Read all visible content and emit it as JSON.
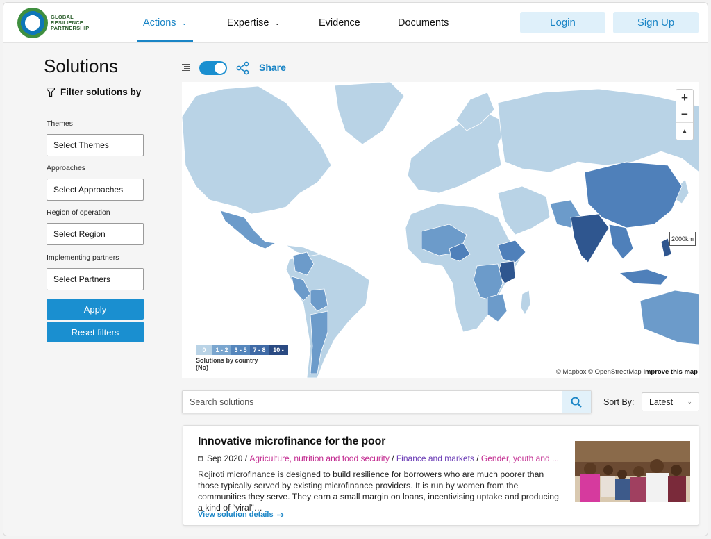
{
  "header": {
    "logo_lines": [
      "GLOBAL",
      "RESILIENCE",
      "PARTNERSHIP"
    ],
    "nav": [
      {
        "label": "Actions",
        "active": true,
        "has_dropdown": true
      },
      {
        "label": "Expertise",
        "active": false,
        "has_dropdown": true
      },
      {
        "label": "Evidence",
        "active": false,
        "has_dropdown": false
      },
      {
        "label": "Documents",
        "active": false,
        "has_dropdown": false
      }
    ],
    "login_label": "Login",
    "signup_label": "Sign Up"
  },
  "sidebar": {
    "title": "Solutions",
    "filter_heading": "Filter solutions by",
    "filters": [
      {
        "label": "Themes",
        "placeholder": "Select Themes"
      },
      {
        "label": "Approaches",
        "placeholder": "Select Approaches"
      },
      {
        "label": "Region of operation",
        "placeholder": "Select Region"
      },
      {
        "label": "Implementing partners",
        "placeholder": "Select Partners"
      }
    ],
    "apply_label": "Apply",
    "reset_label": "Reset filters"
  },
  "toolbar": {
    "map_toggle_on": true,
    "share_label": "Share"
  },
  "map": {
    "zoom_in": "+",
    "zoom_out": "−",
    "compass": "▲",
    "scale_label": "2000km",
    "legend": {
      "bins": [
        {
          "label": "0",
          "color": "#b9d3e6"
        },
        {
          "label": "1 - 2",
          "color": "#7aa6cf"
        },
        {
          "label": "3 - 5",
          "color": "#5586bc"
        },
        {
          "label": "7 - 8",
          "color": "#3f6aa6"
        },
        {
          "label": "10 -",
          "color": "#2a4a82"
        }
      ],
      "title_line1": "Solutions by country",
      "title_line2": "(No)"
    },
    "attribution": "© Mapbox © OpenStreetMap",
    "attribution_link": "Improve this map",
    "colors": {
      "ocean": "#ffffff",
      "land_zero": "#b9d3e6",
      "low": "#6c9bca",
      "mid": "#4f80ba",
      "high": "#2f568f"
    }
  },
  "search": {
    "placeholder": "Search solutions",
    "sort_label": "Sort By:",
    "sort_value": "Latest"
  },
  "results": [
    {
      "title": "Innovative microfinance for the poor",
      "date": "Sep 2020",
      "tags": [
        {
          "text": "Agriculture, nutrition and food security",
          "color": "#c2298f"
        },
        {
          "text": "Finance and markets",
          "color": "#6a3bb5"
        },
        {
          "text": "Gender, youth and ...",
          "color": "#c2298f"
        }
      ],
      "description": "Rojiroti microfinance is designed to build resilience for borrowers who are much poorer than those typically served by existing microfinance providers. It is run by women from the communities they serve. They earn a small margin on loans, incentivising uptake and producing a kind of “viral”…",
      "link_label": "View solution details"
    }
  ]
}
